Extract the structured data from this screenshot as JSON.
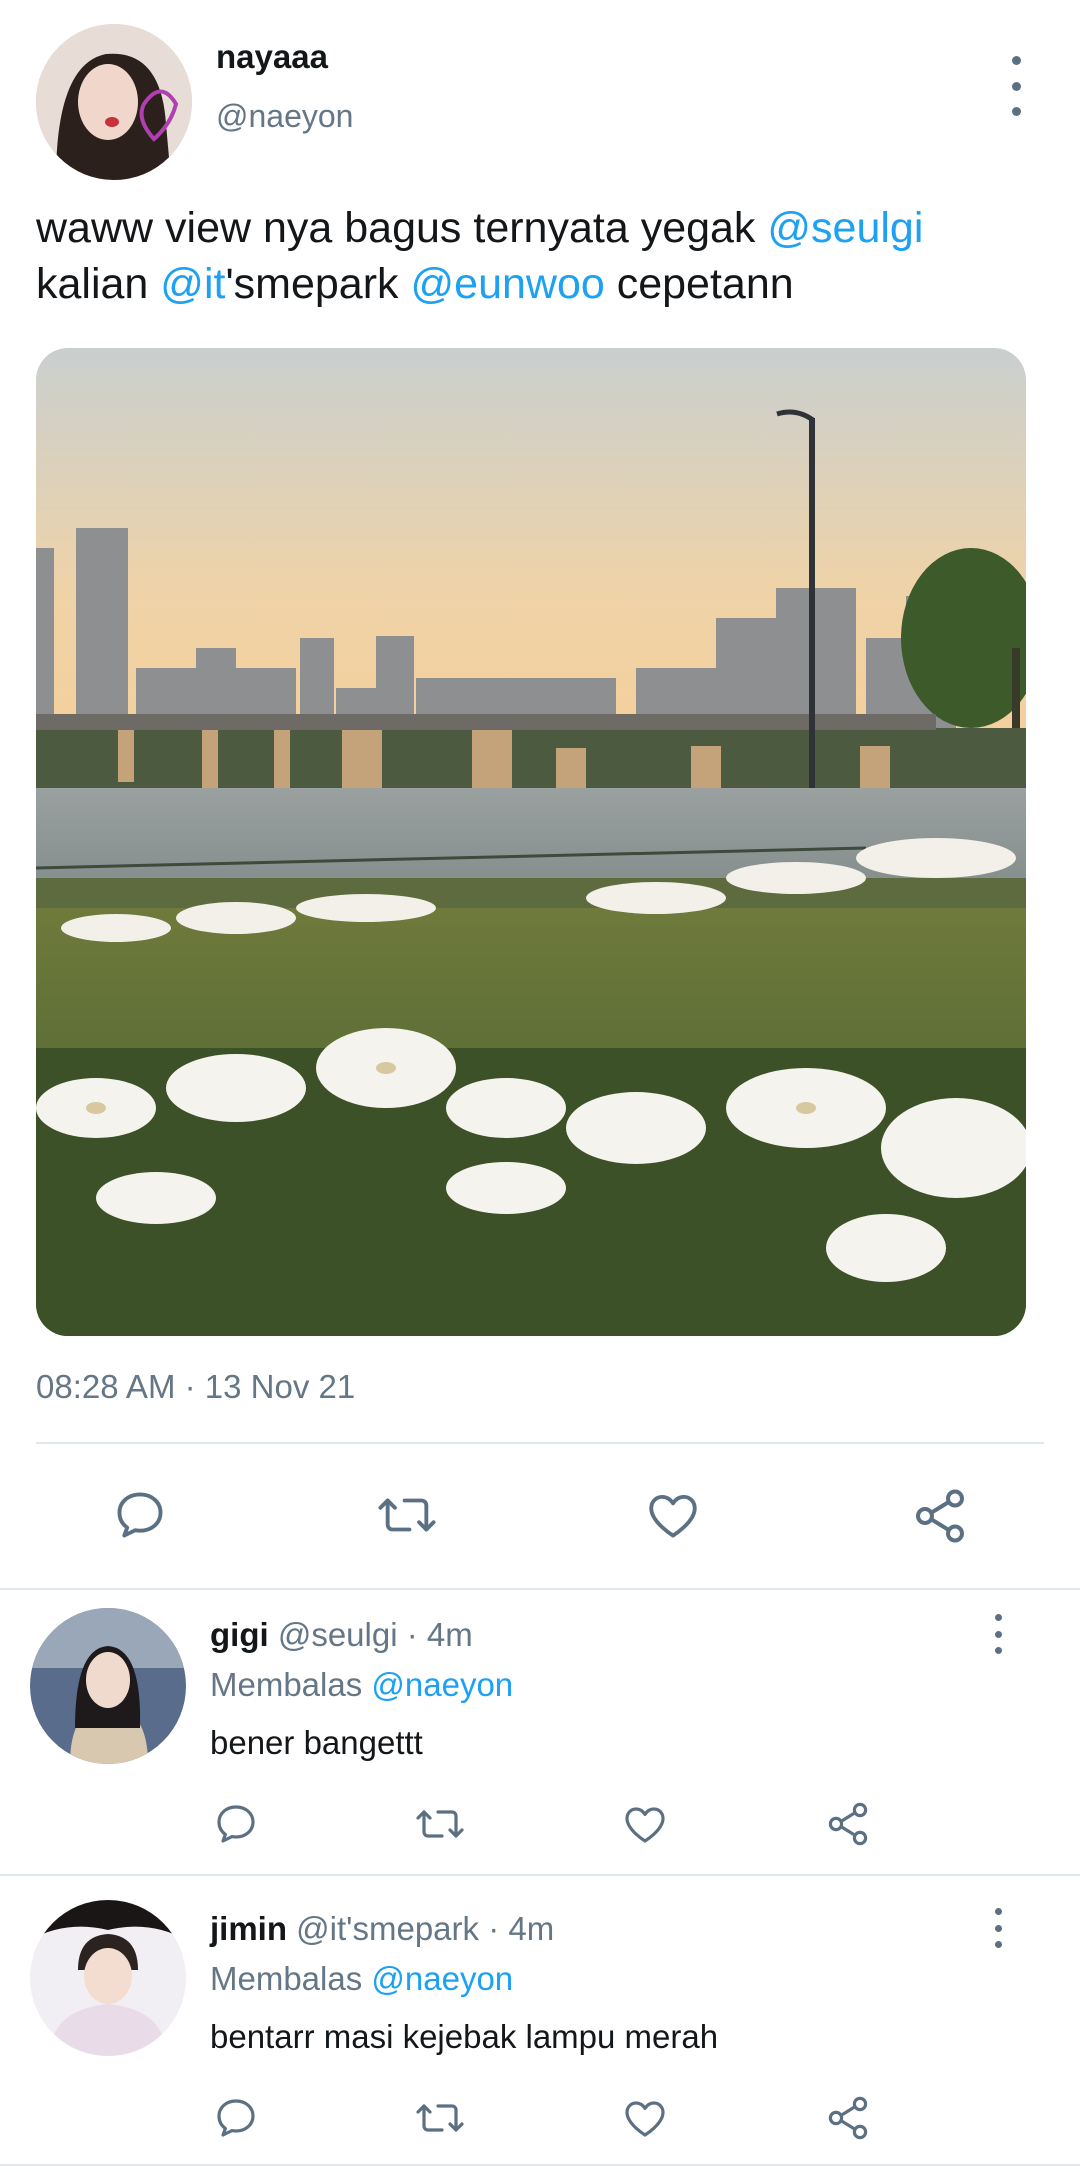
{
  "main_tweet": {
    "display_name": "nayaaa",
    "handle": "@naeyon",
    "text_parts": [
      "waww view nya bagus ternyata yegak ",
      "@seulgi",
      "kalian ",
      "@it",
      "'smepark ",
      "@eunwoo",
      " cepetann"
    ],
    "timestamp": "08:28 AM · 13 Nov 21"
  },
  "replies": [
    {
      "display_name": "gigi",
      "meta": " @seulgi · 4m",
      "replying_prefix": "Membalas ",
      "replying_to": "@naeyon",
      "text": "bener bangettt"
    },
    {
      "display_name": "jimin",
      "meta": " @it'smepark · 4m",
      "replying_prefix": "Membalas ",
      "replying_to": "@naeyon",
      "text": "bentarr masi kejebak lampu merah"
    }
  ],
  "icons": [
    "more-vertical-icon",
    "reply-icon",
    "retweet-icon",
    "like-icon",
    "share-icon"
  ],
  "colors": {
    "accent": "#1da1f2",
    "secondary_text": "#657786",
    "icon": "#5b7083",
    "divider": "#e1e8ed"
  }
}
